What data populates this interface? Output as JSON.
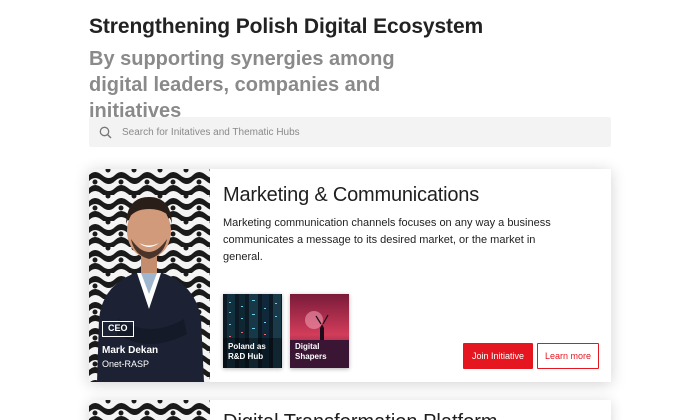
{
  "headline": {
    "title": "Strengthening Polish Digital Ecosystem",
    "subtitle": "By supporting synergies among digital leaders, companies and initiatives"
  },
  "search": {
    "placeholder": "Search for Initatives and Thematic Hubs",
    "icon": "search-icon"
  },
  "card": {
    "title": "Marketing & Communications",
    "description": "Marketing communication channels focuses on any way a business communicates a message to its desired market, or the market in general.",
    "leader": {
      "badge": "CEO",
      "name": "Mark Dekan",
      "organization": "Onet-RASP"
    },
    "hubs": [
      {
        "label": "Poland as R&D Hub"
      },
      {
        "label": "Digital Shapers"
      }
    ],
    "join_label": "Join Initiative",
    "learn_label": "Learn more"
  },
  "card2": {
    "title": "Digital Transformation Platform"
  },
  "colors": {
    "accent": "#e5161f",
    "title": "#222222",
    "subtitle": "#8a8a8a",
    "search_bg": "#f3f3f3"
  }
}
